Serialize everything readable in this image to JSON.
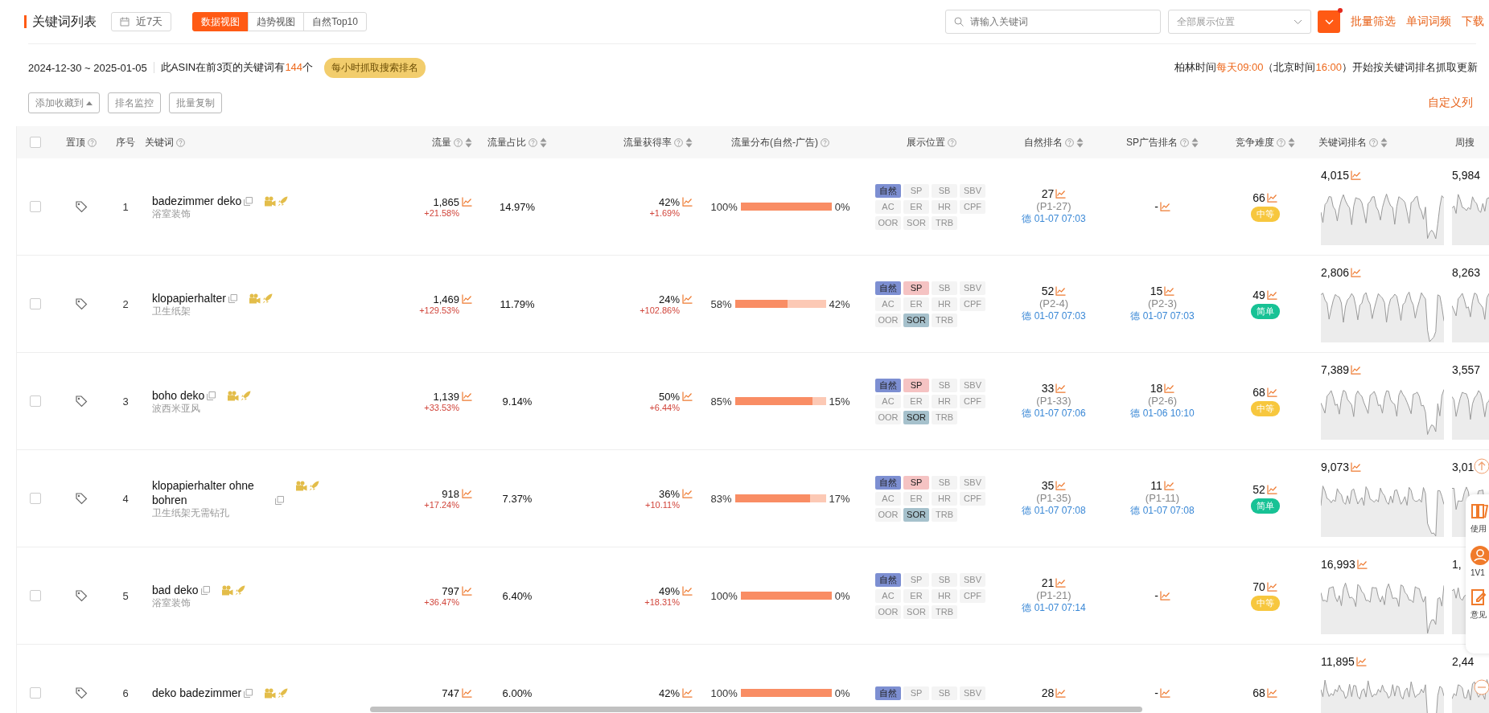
{
  "header": {
    "title": "关键词列表",
    "date_button": "近7天",
    "tabs": [
      {
        "label": "数据视图",
        "selected": true
      },
      {
        "label": "趋势视图",
        "selected": false
      },
      {
        "label": "自然Top10",
        "selected": false
      }
    ],
    "search": {
      "placeholder": "请输入关键词"
    },
    "position_select": {
      "placeholder": "全部展示位置"
    },
    "filter_dot": true,
    "links": [
      "批量筛选",
      "单词词频",
      "下载"
    ]
  },
  "info": {
    "date_range": "2024-12-30 ~ 2025-01-05",
    "summary": "此ASIN在前3页的关键词有**144**个",
    "badge": "每小时抓取搜索排名",
    "schedule": "柏林时间**每天09:00**（北京时间**16:00**）开始按关键词排名抓取更新"
  },
  "actions": {
    "buttons": [
      "添加收藏到",
      "排名监控",
      "批量复制"
    ],
    "customize_link": "自定义列"
  },
  "table": {
    "select_all_checked": false,
    "columns": [
      {
        "label": "置顶",
        "help": true,
        "sortable": false
      },
      {
        "label": "序号",
        "help": false,
        "sortable": false
      },
      {
        "label": "关键词",
        "help": true,
        "sortable": false
      },
      {
        "label": "流量",
        "help": true,
        "sortable": true
      },
      {
        "label": "流量占比",
        "help": true,
        "sortable": true
      },
      {
        "label": "流量获得率",
        "help": true,
        "sortable": true
      },
      {
        "label": "流量分布(自然-广告)",
        "help": true,
        "sortable": false
      },
      {
        "label": "展示位置",
        "help": true,
        "sortable": false
      },
      {
        "label": "自然排名",
        "help": true,
        "sortable": true
      },
      {
        "label": "SP广告排名",
        "help": true,
        "sortable": true
      },
      {
        "label": "竞争难度",
        "help": true,
        "sortable": true
      },
      {
        "label": "关键词排名",
        "help": true,
        "sortable": true
      },
      {
        "label": "周搜",
        "help": false,
        "sortable": false
      }
    ],
    "rows": [
      {
        "checked": false,
        "index": "1",
        "keyword": "badezimmer deko",
        "translation": "浴室装饰",
        "traffic": "1,865",
        "traffic_change": "+21.58%",
        "share": "14.97%",
        "rate": "42%",
        "rate_change": "+1.69%",
        "organic": "100%",
        "ad": "0%",
        "level": 1,
        "positions": [
          {
            "label": "自然",
            "on": true
          },
          {
            "label": "SP",
            "on": false
          },
          {
            "label": "SB",
            "on": false
          },
          {
            "label": "SBV",
            "on": false
          },
          {
            "label": "AC",
            "on": false
          },
          {
            "label": "ER",
            "on": false
          },
          {
            "label": "HR",
            "on": false
          },
          {
            "label": "CPF",
            "on": false
          },
          {
            "label": "OOR",
            "on": false
          },
          {
            "label": "SOR",
            "on": false
          },
          {
            "label": "TRB",
            "on": false
          }
        ],
        "natural_rank": {
          "value": "27",
          "page": "(P1-27)",
          "time": "德 01-07 07:03"
        },
        "sp_rank": {
          "value": "-"
        },
        "difficulty": "66",
        "difficulty_tag": {
          "text": "中等",
          "color": "#f7c73e"
        },
        "keyword_rank": "4,015",
        "weekly": "5,984"
      },
      {
        "checked": false,
        "index": "2",
        "keyword": "klopapierhalter",
        "translation": "卫生纸架",
        "traffic": "1,469",
        "traffic_change": "+129.53%",
        "share": "11.79%",
        "rate": "24%",
        "rate_change": "+102.86%",
        "organic": "58%",
        "ad": "42%",
        "level": 0.58,
        "positions": [
          {
            "label": "自然",
            "on": true
          },
          {
            "label": "SP",
            "on": true
          },
          {
            "label": "SB",
            "on": false
          },
          {
            "label": "SBV",
            "on": false
          },
          {
            "label": "AC",
            "on": false
          },
          {
            "label": "ER",
            "on": false
          },
          {
            "label": "HR",
            "on": false
          },
          {
            "label": "CPF",
            "on": false
          },
          {
            "label": "OOR",
            "on": false
          },
          {
            "label": "SOR",
            "on": true
          },
          {
            "label": "TRB",
            "on": false
          }
        ],
        "natural_rank": {
          "value": "52",
          "page": "(P2-4)",
          "time": "德 01-07 07:03"
        },
        "sp_rank": {
          "value": "15",
          "page": "(P2-3)",
          "time": "德 01-07 07:03"
        },
        "difficulty": "49",
        "difficulty_tag": {
          "text": "简单",
          "color": "#17c295"
        },
        "keyword_rank": "2,806",
        "weekly": "8,263"
      },
      {
        "checked": false,
        "index": "3",
        "keyword": "boho deko",
        "translation": "波西米亚风",
        "traffic": "1,139",
        "traffic_change": "+33.53%",
        "share": "9.14%",
        "rate": "50%",
        "rate_change": "+6.44%",
        "organic": "85%",
        "ad": "15%",
        "level": 0.85,
        "positions": [
          {
            "label": "自然",
            "on": true
          },
          {
            "label": "SP",
            "on": true
          },
          {
            "label": "SB",
            "on": false
          },
          {
            "label": "SBV",
            "on": false
          },
          {
            "label": "AC",
            "on": false
          },
          {
            "label": "ER",
            "on": false
          },
          {
            "label": "HR",
            "on": false
          },
          {
            "label": "CPF",
            "on": false
          },
          {
            "label": "OOR",
            "on": false
          },
          {
            "label": "SOR",
            "on": true
          },
          {
            "label": "TRB",
            "on": false
          }
        ],
        "natural_rank": {
          "value": "33",
          "page": "(P1-33)",
          "time": "德 01-07 07:06"
        },
        "sp_rank": {
          "value": "18",
          "page": "(P2-6)",
          "time": "德 01-06 10:10"
        },
        "difficulty": "68",
        "difficulty_tag": {
          "text": "中等",
          "color": "#f7c73e"
        },
        "keyword_rank": "7,389",
        "weekly": "3,557"
      },
      {
        "checked": false,
        "index": "4",
        "keyword": "klopapierhalter ohne bohren",
        "translation": "卫生纸架无需钻孔",
        "traffic": "918",
        "traffic_change": "+17.24%",
        "share": "7.37%",
        "rate": "36%",
        "rate_change": "+10.11%",
        "organic": "83%",
        "ad": "17%",
        "level": 0.83,
        "positions": [
          {
            "label": "自然",
            "on": true
          },
          {
            "label": "SP",
            "on": true
          },
          {
            "label": "SB",
            "on": false
          },
          {
            "label": "SBV",
            "on": false
          },
          {
            "label": "AC",
            "on": false
          },
          {
            "label": "ER",
            "on": false
          },
          {
            "label": "HR",
            "on": false
          },
          {
            "label": "CPF",
            "on": false
          },
          {
            "label": "OOR",
            "on": false
          },
          {
            "label": "SOR",
            "on": true
          },
          {
            "label": "TRB",
            "on": false
          }
        ],
        "natural_rank": {
          "value": "35",
          "page": "(P1-35)",
          "time": "德 01-07 07:08"
        },
        "sp_rank": {
          "value": "11",
          "page": "(P1-11)",
          "time": "德 01-07 07:08"
        },
        "difficulty": "52",
        "difficulty_tag": {
          "text": "简单",
          "color": "#17c295"
        },
        "keyword_rank": "9,073",
        "weekly": "3,01"
      },
      {
        "checked": false,
        "index": "5",
        "keyword": "bad deko",
        "translation": "浴室装饰",
        "traffic": "797",
        "traffic_change": "+36.47%",
        "share": "6.40%",
        "rate": "49%",
        "rate_change": "+18.31%",
        "organic": "100%",
        "ad": "0%",
        "level": 1,
        "positions": [
          {
            "label": "自然",
            "on": true
          },
          {
            "label": "SP",
            "on": false
          },
          {
            "label": "SB",
            "on": false
          },
          {
            "label": "SBV",
            "on": false
          },
          {
            "label": "AC",
            "on": false
          },
          {
            "label": "ER",
            "on": false
          },
          {
            "label": "HR",
            "on": false
          },
          {
            "label": "CPF",
            "on": false
          },
          {
            "label": "OOR",
            "on": false
          },
          {
            "label": "SOR",
            "on": false
          },
          {
            "label": "TRB",
            "on": false
          }
        ],
        "natural_rank": {
          "value": "21",
          "page": "(P1-21)",
          "time": "德 01-07 07:14"
        },
        "sp_rank": {
          "value": "-"
        },
        "difficulty": "70",
        "difficulty_tag": {
          "text": "中等",
          "color": "#f7c73e"
        },
        "keyword_rank": "16,993",
        "weekly": "1,"
      },
      {
        "checked": false,
        "index": "6",
        "keyword": "deko badezimmer",
        "traffic": "747",
        "share": "6.00%",
        "rate": "42%",
        "organic": "100%",
        "ad": "0%",
        "level": 1,
        "positions": [
          {
            "label": "自然",
            "on": true
          },
          {
            "label": "SP",
            "on": false
          },
          {
            "label": "SB",
            "on": false
          },
          {
            "label": "SBV",
            "on": false
          }
        ],
        "natural_rank": {
          "value": "28"
        },
        "sp_rank": {
          "value": "-"
        },
        "difficulty": "68",
        "keyword_rank": "11,895",
        "weekly": "2,44"
      }
    ]
  },
  "side_panel": {
    "items": [
      "使用",
      "1V1",
      "意见"
    ]
  }
}
